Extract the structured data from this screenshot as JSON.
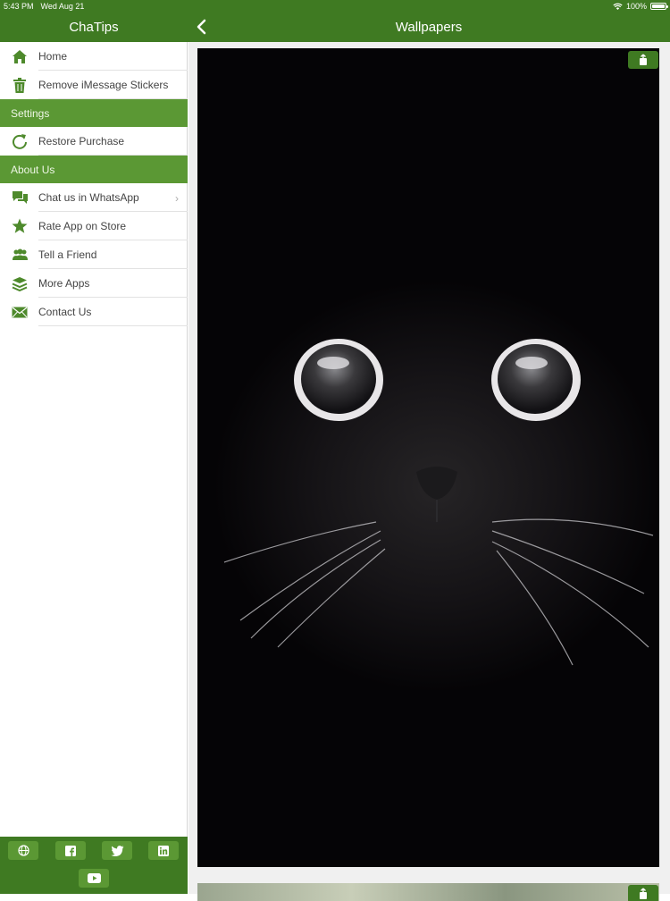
{
  "status_bar": {
    "time": "5:43 PM",
    "date": "Wed Aug 21",
    "battery": "100%"
  },
  "sidebar": {
    "title": "ChaTips",
    "items": [
      {
        "label": "Home",
        "icon": "home-icon"
      },
      {
        "label": "Remove iMessage Stickers",
        "icon": "trash-icon"
      }
    ],
    "settings_header": "Settings",
    "settings_items": [
      {
        "label": "Restore Purchase",
        "icon": "restore-icon"
      }
    ],
    "about_header": "About Us",
    "about_items": [
      {
        "label": "Chat us in WhatsApp",
        "icon": "chat-icon"
      },
      {
        "label": "Rate App on Store",
        "icon": "star-icon"
      },
      {
        "label": "Tell a Friend",
        "icon": "friends-icon"
      },
      {
        "label": "More Apps",
        "icon": "layers-icon"
      },
      {
        "label": "Contact Us",
        "icon": "mail-icon"
      }
    ],
    "social": [
      "globe-icon",
      "facebook-icon",
      "twitter-icon",
      "linkedin-icon",
      "youtube-icon"
    ]
  },
  "main": {
    "title": "Wallpapers",
    "wallpapers": [
      "black-cat-wallpaper",
      "second-wallpaper"
    ]
  },
  "colors": {
    "header": "#3f7a22",
    "section": "#5b9834",
    "icon": "#4e8a2c"
  }
}
